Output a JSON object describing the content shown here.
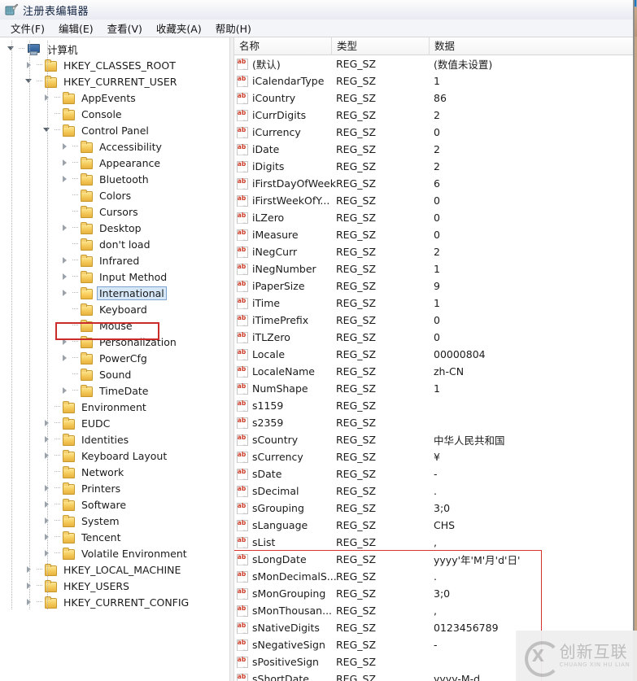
{
  "window": {
    "title": "注册表编辑器",
    "icon": "registry-editor-icon"
  },
  "menubar": {
    "items": [
      {
        "label": "文件(F)",
        "name": "menu-file"
      },
      {
        "label": "编辑(E)",
        "name": "menu-edit"
      },
      {
        "label": "查看(V)",
        "name": "menu-view"
      },
      {
        "label": "收藏夹(A)",
        "name": "menu-favorites"
      },
      {
        "label": "帮助(H)",
        "name": "menu-help"
      }
    ]
  },
  "tree": {
    "nodes": [
      {
        "label": "计算机",
        "depth": 0,
        "twisty": "open",
        "icon": "computer-icon",
        "selected": false
      },
      {
        "label": "HKEY_CLASSES_ROOT",
        "depth": 1,
        "twisty": "closed",
        "icon": "folder-icon",
        "selected": false
      },
      {
        "label": "HKEY_CURRENT_USER",
        "depth": 1,
        "twisty": "open",
        "icon": "folder-icon",
        "selected": false
      },
      {
        "label": "AppEvents",
        "depth": 2,
        "twisty": "closed",
        "icon": "folder-icon",
        "selected": false
      },
      {
        "label": "Console",
        "depth": 2,
        "twisty": "none",
        "icon": "folder-icon",
        "selected": false
      },
      {
        "label": "Control Panel",
        "depth": 2,
        "twisty": "open",
        "icon": "folder-icon",
        "selected": false
      },
      {
        "label": "Accessibility",
        "depth": 3,
        "twisty": "closed",
        "icon": "folder-icon",
        "selected": false
      },
      {
        "label": "Appearance",
        "depth": 3,
        "twisty": "closed",
        "icon": "folder-icon",
        "selected": false
      },
      {
        "label": "Bluetooth",
        "depth": 3,
        "twisty": "closed",
        "icon": "folder-icon",
        "selected": false
      },
      {
        "label": "Colors",
        "depth": 3,
        "twisty": "none",
        "icon": "folder-icon",
        "selected": false
      },
      {
        "label": "Cursors",
        "depth": 3,
        "twisty": "none",
        "icon": "folder-icon",
        "selected": false
      },
      {
        "label": "Desktop",
        "depth": 3,
        "twisty": "closed",
        "icon": "folder-icon",
        "selected": false
      },
      {
        "label": "don't load",
        "depth": 3,
        "twisty": "none",
        "icon": "folder-icon",
        "selected": false
      },
      {
        "label": "Infrared",
        "depth": 3,
        "twisty": "closed",
        "icon": "folder-icon",
        "selected": false
      },
      {
        "label": "Input Method",
        "depth": 3,
        "twisty": "closed",
        "icon": "folder-icon",
        "selected": false
      },
      {
        "label": "International",
        "depth": 3,
        "twisty": "closed",
        "icon": "folder-icon",
        "selected": true
      },
      {
        "label": "Keyboard",
        "depth": 3,
        "twisty": "none",
        "icon": "folder-icon",
        "selected": false
      },
      {
        "label": "Mouse",
        "depth": 3,
        "twisty": "none",
        "icon": "folder-icon",
        "selected": false
      },
      {
        "label": "Personalization",
        "depth": 3,
        "twisty": "closed",
        "icon": "folder-icon",
        "selected": false
      },
      {
        "label": "PowerCfg",
        "depth": 3,
        "twisty": "closed",
        "icon": "folder-icon",
        "selected": false
      },
      {
        "label": "Sound",
        "depth": 3,
        "twisty": "none",
        "icon": "folder-icon",
        "selected": false
      },
      {
        "label": "TimeDate",
        "depth": 3,
        "twisty": "closed",
        "icon": "folder-icon",
        "selected": false
      },
      {
        "label": "Environment",
        "depth": 2,
        "twisty": "none",
        "icon": "folder-icon",
        "selected": false
      },
      {
        "label": "EUDC",
        "depth": 2,
        "twisty": "closed",
        "icon": "folder-icon",
        "selected": false
      },
      {
        "label": "Identities",
        "depth": 2,
        "twisty": "closed",
        "icon": "folder-icon",
        "selected": false
      },
      {
        "label": "Keyboard Layout",
        "depth": 2,
        "twisty": "closed",
        "icon": "folder-icon",
        "selected": false
      },
      {
        "label": "Network",
        "depth": 2,
        "twisty": "none",
        "icon": "folder-icon",
        "selected": false
      },
      {
        "label": "Printers",
        "depth": 2,
        "twisty": "closed",
        "icon": "folder-icon",
        "selected": false
      },
      {
        "label": "Software",
        "depth": 2,
        "twisty": "closed",
        "icon": "folder-icon",
        "selected": false
      },
      {
        "label": "System",
        "depth": 2,
        "twisty": "closed",
        "icon": "folder-icon",
        "selected": false
      },
      {
        "label": "Tencent",
        "depth": 2,
        "twisty": "closed",
        "icon": "folder-icon",
        "selected": false
      },
      {
        "label": "Volatile Environment",
        "depth": 2,
        "twisty": "closed",
        "icon": "folder-icon",
        "selected": false
      },
      {
        "label": "HKEY_LOCAL_MACHINE",
        "depth": 1,
        "twisty": "closed",
        "icon": "folder-icon",
        "selected": false
      },
      {
        "label": "HKEY_USERS",
        "depth": 1,
        "twisty": "closed",
        "icon": "folder-icon",
        "selected": false
      },
      {
        "label": "HKEY_CURRENT_CONFIG",
        "depth": 1,
        "twisty": "closed",
        "icon": "folder-icon",
        "selected": false
      }
    ]
  },
  "list": {
    "columns": [
      "名称",
      "类型",
      "数据"
    ],
    "rows": [
      {
        "name": "(默认)",
        "type": "REG_SZ",
        "data": "(数值未设置)"
      },
      {
        "name": "iCalendarType",
        "type": "REG_SZ",
        "data": "1"
      },
      {
        "name": "iCountry",
        "type": "REG_SZ",
        "data": "86"
      },
      {
        "name": "iCurrDigits",
        "type": "REG_SZ",
        "data": "2"
      },
      {
        "name": "iCurrency",
        "type": "REG_SZ",
        "data": "0"
      },
      {
        "name": "iDate",
        "type": "REG_SZ",
        "data": "2"
      },
      {
        "name": "iDigits",
        "type": "REG_SZ",
        "data": "2"
      },
      {
        "name": "iFirstDayOfWeek",
        "type": "REG_SZ",
        "data": "6"
      },
      {
        "name": "iFirstWeekOfY...",
        "type": "REG_SZ",
        "data": "0"
      },
      {
        "name": "iLZero",
        "type": "REG_SZ",
        "data": "0"
      },
      {
        "name": "iMeasure",
        "type": "REG_SZ",
        "data": "0"
      },
      {
        "name": "iNegCurr",
        "type": "REG_SZ",
        "data": "2"
      },
      {
        "name": "iNegNumber",
        "type": "REG_SZ",
        "data": "1"
      },
      {
        "name": "iPaperSize",
        "type": "REG_SZ",
        "data": "9"
      },
      {
        "name": "iTime",
        "type": "REG_SZ",
        "data": "1"
      },
      {
        "name": "iTimePrefix",
        "type": "REG_SZ",
        "data": "0"
      },
      {
        "name": "iTLZero",
        "type": "REG_SZ",
        "data": "0"
      },
      {
        "name": "Locale",
        "type": "REG_SZ",
        "data": "00000804"
      },
      {
        "name": "LocaleName",
        "type": "REG_SZ",
        "data": "zh-CN"
      },
      {
        "name": "NumShape",
        "type": "REG_SZ",
        "data": "1"
      },
      {
        "name": "s1159",
        "type": "REG_SZ",
        "data": ""
      },
      {
        "name": "s2359",
        "type": "REG_SZ",
        "data": ""
      },
      {
        "name": "sCountry",
        "type": "REG_SZ",
        "data": "中华人民共和国"
      },
      {
        "name": "sCurrency",
        "type": "REG_SZ",
        "data": "¥"
      },
      {
        "name": "sDate",
        "type": "REG_SZ",
        "data": "-"
      },
      {
        "name": "sDecimal",
        "type": "REG_SZ",
        "data": "."
      },
      {
        "name": "sGrouping",
        "type": "REG_SZ",
        "data": "3;0"
      },
      {
        "name": "sLanguage",
        "type": "REG_SZ",
        "data": "CHS"
      },
      {
        "name": "sList",
        "type": "REG_SZ",
        "data": ","
      },
      {
        "name": "sLongDate",
        "type": "REG_SZ",
        "data": "yyyy'年'M'月'd'日'"
      },
      {
        "name": "sMonDecimalS...",
        "type": "REG_SZ",
        "data": "."
      },
      {
        "name": "sMonGrouping",
        "type": "REG_SZ",
        "data": "3;0"
      },
      {
        "name": "sMonThousan...",
        "type": "REG_SZ",
        "data": ","
      },
      {
        "name": "sNativeDigits",
        "type": "REG_SZ",
        "data": "0123456789"
      },
      {
        "name": "sNegativeSign",
        "type": "REG_SZ",
        "data": "-"
      },
      {
        "name": "sPositiveSign",
        "type": "REG_SZ",
        "data": ""
      },
      {
        "name": "sShortDate",
        "type": "REG_SZ",
        "data": "yyyy-M-d"
      }
    ]
  },
  "annotations": {
    "color": "#cc2b2b",
    "tree_highlight_label": "International",
    "list_highlight_start_label": "sLongDate"
  },
  "watermark": {
    "cn": "创新互联",
    "pinyin": "CHUANG XIN HU LIAN",
    "mark": "cx-logo-icon"
  }
}
